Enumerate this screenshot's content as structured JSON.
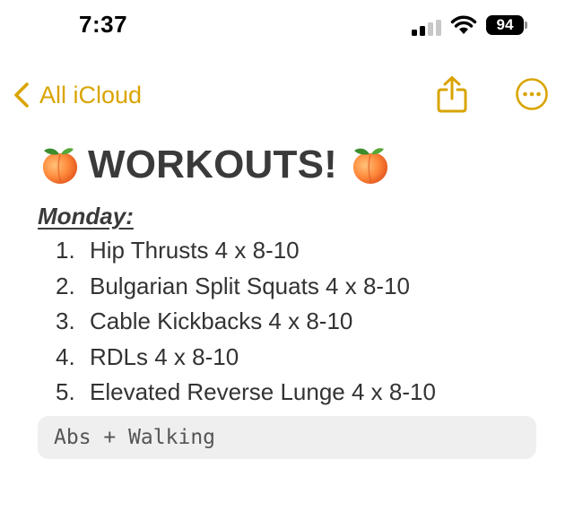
{
  "status_bar": {
    "time": "7:37",
    "battery_level": "94",
    "signal_bars_active": 2,
    "signal_bars_total": 4
  },
  "nav": {
    "back_label": "All iCloud",
    "accent_color": "#d9a400",
    "share_icon": "share-icon",
    "more_icon": "more-ellipsis-icon"
  },
  "note": {
    "title": "WORKOUTS!",
    "title_emoji": "peach",
    "day_heading": "Monday:",
    "exercises": [
      {
        "num": "1.",
        "text": "Hip Thrusts 4 x 8-10"
      },
      {
        "num": "2.",
        "text": "Bulgarian Split Squats 4 x 8-10"
      },
      {
        "num": "3.",
        "text": "Cable Kickbacks 4 x 8-10"
      },
      {
        "num": "4.",
        "text": "RDLs 4 x 8-10"
      },
      {
        "num": "5.",
        "text": "Elevated Reverse Lunge 4 x 8-10"
      }
    ],
    "code_block": "Abs + Walking"
  }
}
